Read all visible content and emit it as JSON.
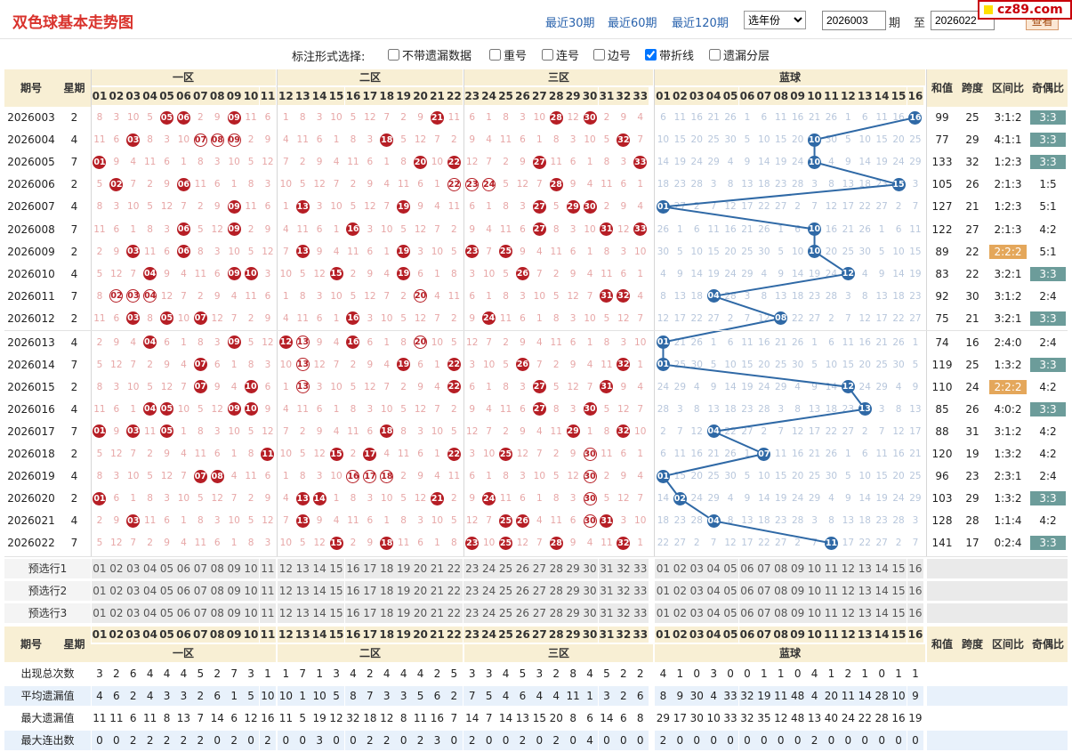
{
  "title": "双色球基本走势图",
  "links": [
    "最近30期",
    "最近60期",
    "最近120期"
  ],
  "year_select": "选年份",
  "issue_from": "2026003",
  "issue_to_label": "至",
  "issue_label": "期",
  "issue_to": "2026022",
  "view_button": "查看",
  "site_badge": "cz89.com",
  "options_label": "标注形式选择:",
  "options": [
    {
      "label": "不带遗漏数据",
      "checked": false
    },
    {
      "label": "重号",
      "checked": false
    },
    {
      "label": "连号",
      "checked": false
    },
    {
      "label": "边号",
      "checked": false
    },
    {
      "label": "带折线",
      "checked": true
    },
    {
      "label": "遗漏分层",
      "checked": false
    }
  ],
  "headers": {
    "issue": "期号",
    "weekday": "星期",
    "zone1": "一区",
    "zone2": "二区",
    "zone3": "三区",
    "blue": "蓝球",
    "sum": "和值",
    "span": "跨度",
    "zone_ratio": "区间比",
    "odd_even": "奇偶比"
  },
  "colors": {
    "red_ball": "#b61e25",
    "blue_ball": "#2f69a6",
    "odd_even_normal": "#6c9c9a",
    "odd_even_highlight": "#e4a75b",
    "header_bg": "#f8efd4"
  },
  "rows": [
    {
      "issue": "2026003",
      "week": "2",
      "reds": [
        5,
        6,
        9,
        21,
        28,
        30
      ],
      "blue": 16,
      "sum": "99",
      "span": "25",
      "zr": "3:1:2",
      "oe": "3:3",
      "hl_zr": false,
      "oe_box": true,
      "ring": []
    },
    {
      "issue": "2026004",
      "week": "4",
      "reds": [
        3,
        7,
        8,
        9,
        18,
        32
      ],
      "blue": 10,
      "sum": "77",
      "span": "29",
      "zr": "4:1:1",
      "oe": "3:3",
      "hl_zr": false,
      "oe_box": true,
      "ring": [
        7,
        8,
        9
      ]
    },
    {
      "issue": "2026005",
      "week": "7",
      "reds": [
        1,
        20,
        22,
        27,
        33
      ],
      "blue": 10,
      "sum": "133",
      "span": "32",
      "zr": "1:2:3",
      "oe": "3:3",
      "hl_zr": false,
      "oe_box": true,
      "ring": []
    },
    {
      "issue": "2026006",
      "week": "2",
      "reds": [
        2,
        6,
        22,
        23,
        24,
        28
      ],
      "blue": 15,
      "sum": "105",
      "span": "26",
      "zr": "2:1:3",
      "oe": "1:5",
      "hl_zr": false,
      "oe_box": false,
      "ring": [
        22,
        23,
        24
      ]
    },
    {
      "issue": "2026007",
      "week": "4",
      "reds": [
        9,
        13,
        19,
        27,
        29,
        30
      ],
      "blue": 1,
      "sum": "127",
      "span": "21",
      "zr": "1:2:3",
      "oe": "5:1",
      "hl_zr": false,
      "oe_box": false,
      "ring": []
    },
    {
      "issue": "2026008",
      "week": "7",
      "reds": [
        6,
        9,
        16,
        27,
        31,
        33
      ],
      "blue": 10,
      "sum": "122",
      "span": "27",
      "zr": "2:1:3",
      "oe": "4:2",
      "hl_zr": false,
      "oe_box": false,
      "ring": []
    },
    {
      "issue": "2026009",
      "week": "2",
      "reds": [
        3,
        6,
        13,
        19,
        23,
        25
      ],
      "blue": 10,
      "sum": "89",
      "span": "22",
      "zr": "2:2:2",
      "oe": "5:1",
      "hl_zr": true,
      "oe_box": false,
      "ring": []
    },
    {
      "issue": "2026010",
      "week": "4",
      "reds": [
        4,
        9,
        10,
        15,
        19,
        26
      ],
      "blue": 12,
      "sum": "83",
      "span": "22",
      "zr": "3:2:1",
      "oe": "3:3",
      "hl_zr": false,
      "oe_box": true,
      "ring": []
    },
    {
      "issue": "2026011",
      "week": "7",
      "reds": [
        2,
        3,
        4,
        20,
        31,
        32
      ],
      "blue": 4,
      "sum": "92",
      "span": "30",
      "zr": "3:1:2",
      "oe": "2:4",
      "hl_zr": false,
      "oe_box": false,
      "ring": [
        2,
        3,
        4,
        20
      ]
    },
    {
      "issue": "2026012",
      "week": "2",
      "reds": [
        3,
        5,
        7,
        16,
        24
      ],
      "blue": 8,
      "sum": "75",
      "span": "21",
      "zr": "3:2:1",
      "oe": "3:3",
      "hl_zr": false,
      "oe_box": true,
      "ring": []
    },
    {
      "issue": "2026013",
      "week": "4",
      "reds": [
        4,
        9,
        12,
        13,
        16,
        20
      ],
      "blue": 1,
      "sum": "74",
      "span": "16",
      "zr": "2:4:0",
      "oe": "2:4",
      "hl_zr": false,
      "oe_box": false,
      "ring": [
        13,
        20
      ]
    },
    {
      "issue": "2026014",
      "week": "7",
      "reds": [
        7,
        13,
        19,
        22,
        26,
        32
      ],
      "blue": 1,
      "sum": "119",
      "span": "25",
      "zr": "1:3:2",
      "oe": "3:3",
      "hl_zr": false,
      "oe_box": true,
      "ring": [
        13
      ]
    },
    {
      "issue": "2026015",
      "week": "2",
      "reds": [
        7,
        10,
        13,
        22,
        27,
        31
      ],
      "blue": 12,
      "sum": "110",
      "span": "24",
      "zr": "2:2:2",
      "oe": "4:2",
      "hl_zr": true,
      "oe_box": false,
      "ring": [
        13
      ]
    },
    {
      "issue": "2026016",
      "week": "4",
      "reds": [
        4,
        5,
        9,
        10,
        27,
        30
      ],
      "blue": 13,
      "sum": "85",
      "span": "26",
      "zr": "4:0:2",
      "oe": "3:3",
      "hl_zr": false,
      "oe_box": true,
      "ring": []
    },
    {
      "issue": "2026017",
      "week": "7",
      "reds": [
        1,
        3,
        5,
        18,
        29,
        32
      ],
      "blue": 4,
      "sum": "88",
      "span": "31",
      "zr": "3:1:2",
      "oe": "4:2",
      "hl_zr": false,
      "oe_box": false,
      "ring": []
    },
    {
      "issue": "2026018",
      "week": "2",
      "reds": [
        11,
        15,
        17,
        22,
        25,
        30
      ],
      "blue": 7,
      "sum": "120",
      "span": "19",
      "zr": "1:3:2",
      "oe": "4:2",
      "hl_zr": false,
      "oe_box": false,
      "ring": [
        30
      ]
    },
    {
      "issue": "2026019",
      "week": "4",
      "reds": [
        7,
        8,
        16,
        17,
        18,
        30
      ],
      "blue": 1,
      "sum": "96",
      "span": "23",
      "zr": "2:3:1",
      "oe": "2:4",
      "hl_zr": false,
      "oe_box": false,
      "ring": [
        16,
        17,
        18,
        30
      ]
    },
    {
      "issue": "2026020",
      "week": "2",
      "reds": [
        1,
        13,
        14,
        21,
        24,
        30
      ],
      "blue": 2,
      "sum": "103",
      "span": "29",
      "zr": "1:3:2",
      "oe": "3:3",
      "hl_zr": false,
      "oe_box": true,
      "ring": [
        30
      ]
    },
    {
      "issue": "2026021",
      "week": "4",
      "reds": [
        3,
        13,
        25,
        26,
        30,
        31
      ],
      "blue": 4,
      "sum": "128",
      "span": "28",
      "zr": "1:1:4",
      "oe": "4:2",
      "hl_zr": false,
      "oe_box": false,
      "ring": [
        30
      ]
    },
    {
      "issue": "2026022",
      "week": "7",
      "reds": [
        15,
        18,
        23,
        25,
        28,
        32
      ],
      "blue": 11,
      "sum": "141",
      "span": "17",
      "zr": "0:2:4",
      "oe": "3:3",
      "hl_zr": false,
      "oe_box": true,
      "ring": []
    }
  ],
  "preselect": [
    "预选行1",
    "预选行2",
    "预选行3"
  ],
  "stats": [
    {
      "label": "出现总次数",
      "red": [
        3,
        2,
        6,
        4,
        4,
        4,
        5,
        2,
        7,
        3,
        1,
        1,
        7,
        1,
        3,
        4,
        2,
        4,
        4,
        4,
        2,
        5,
        3,
        3,
        4,
        5,
        3,
        2,
        8,
        4,
        5,
        2
      ],
      "red33": 2,
      "blue": [
        4,
        1,
        0,
        3,
        0,
        0,
        1,
        1,
        0,
        4,
        1,
        2,
        1,
        0,
        1,
        1
      ]
    },
    {
      "label": "平均遗漏值",
      "red": [
        4,
        6,
        2,
        4,
        3,
        3,
        2,
        6,
        1,
        5,
        10,
        10,
        1,
        10,
        5,
        8,
        7,
        3,
        3,
        5,
        6,
        2,
        7,
        5,
        4,
        6,
        4,
        4,
        11,
        1,
        3,
        2
      ],
      "red33": 6,
      "blue": [
        8,
        9,
        30,
        4,
        33,
        32,
        19,
        11,
        48,
        4,
        20,
        11,
        14,
        28,
        10,
        9
      ]
    },
    {
      "label": "最大遗漏值",
      "red": [
        11,
        11,
        6,
        11,
        8,
        13,
        7,
        14,
        6,
        12,
        16,
        11,
        5,
        19,
        12,
        32,
        18,
        12,
        8,
        11,
        16,
        7,
        14,
        7,
        14,
        13,
        15,
        20,
        8,
        6,
        14,
        6
      ],
      "red33": 8,
      "blue": [
        29,
        17,
        30,
        10,
        33,
        32,
        35,
        12,
        48,
        13,
        40,
        24,
        22,
        28,
        16,
        19
      ]
    },
    {
      "label": "最大连出数",
      "red": [
        0,
        0,
        2,
        2,
        2,
        2,
        2,
        0,
        2,
        0,
        2,
        0,
        0,
        3,
        0,
        0,
        2,
        2,
        0,
        2,
        3,
        0,
        2,
        0,
        0,
        2,
        0,
        2,
        0,
        4,
        0,
        0
      ],
      "red33": 0,
      "blue": [
        2,
        0,
        0,
        0,
        0,
        0,
        0,
        0,
        0,
        2,
        0,
        0,
        0,
        0,
        0,
        0
      ]
    }
  ]
}
